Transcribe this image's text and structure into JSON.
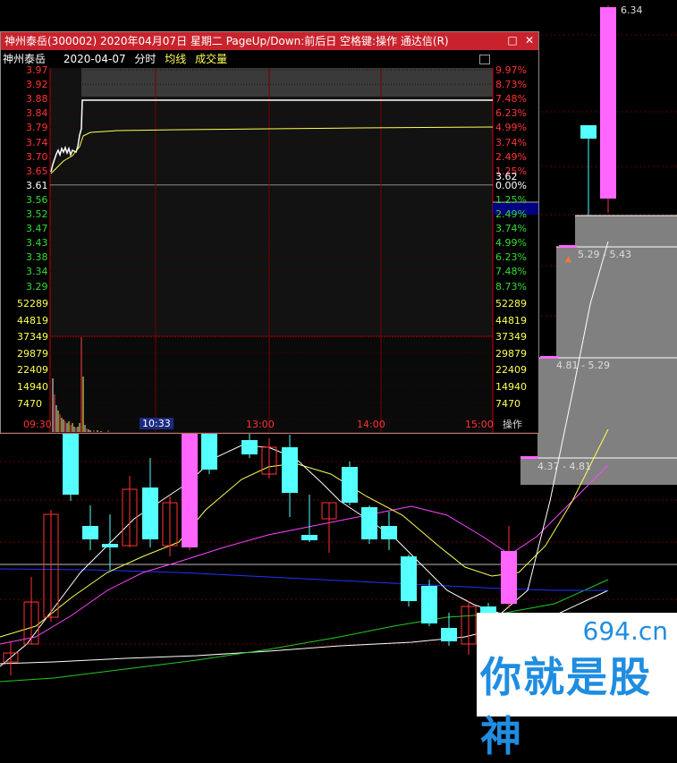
{
  "kline": {
    "price_labels": [
      {
        "label": "5.29 - 5.43"
      },
      {
        "label": "4.81 - 5.29"
      },
      {
        "label": "4.37 - 4.81"
      }
    ],
    "high_label": "6.34",
    "colors": {
      "up": "#ff66ff",
      "down": "#55ffff",
      "yellow": "#ffff55",
      "white": "#ffffff",
      "magenta": "#ff44ff",
      "blue": "#2233ff",
      "green": "#22cc22",
      "panel": "#808080"
    }
  },
  "window": {
    "title": "神州泰岳(300002) 2020年04月07日 星期二 PageUp/Down:前后日 空格键:操作 通达信(R)",
    "restore_glyph": "□",
    "close_glyph": "✕",
    "header": {
      "name": "神州泰岳",
      "date": "2020-04-07",
      "mode": "分时",
      "avg": "均线",
      "vol": "成交量"
    },
    "price_ticks": [
      "3.97",
      "3.92",
      "3.88",
      "3.84",
      "3.79",
      "3.74",
      "3.70",
      "3.65",
      "3.61",
      "3.56",
      "3.52",
      "3.47",
      "3.43",
      "3.38",
      "3.34",
      "3.29"
    ],
    "pct_ticks": [
      "9.97%",
      "8.73%",
      "7.48%",
      "6.23%",
      "4.99%",
      "3.74%",
      "2.49%",
      "1.25%",
      "0.00%",
      "1.25%",
      "2.49%",
      "3.74%",
      "4.99%",
      "6.23%",
      "7.48%",
      "8.73%"
    ],
    "current_price": "3.62",
    "volume_ticks": [
      "52289",
      "44819",
      "37349",
      "29879",
      "22409",
      "14940",
      "7470"
    ],
    "time_ticks": [
      "09:30",
      "10:33",
      "13:00",
      "14:00",
      "15:00"
    ],
    "action_label": "操作"
  },
  "watermark": {
    "url": "694.cn",
    "text": "你就是股神"
  }
}
